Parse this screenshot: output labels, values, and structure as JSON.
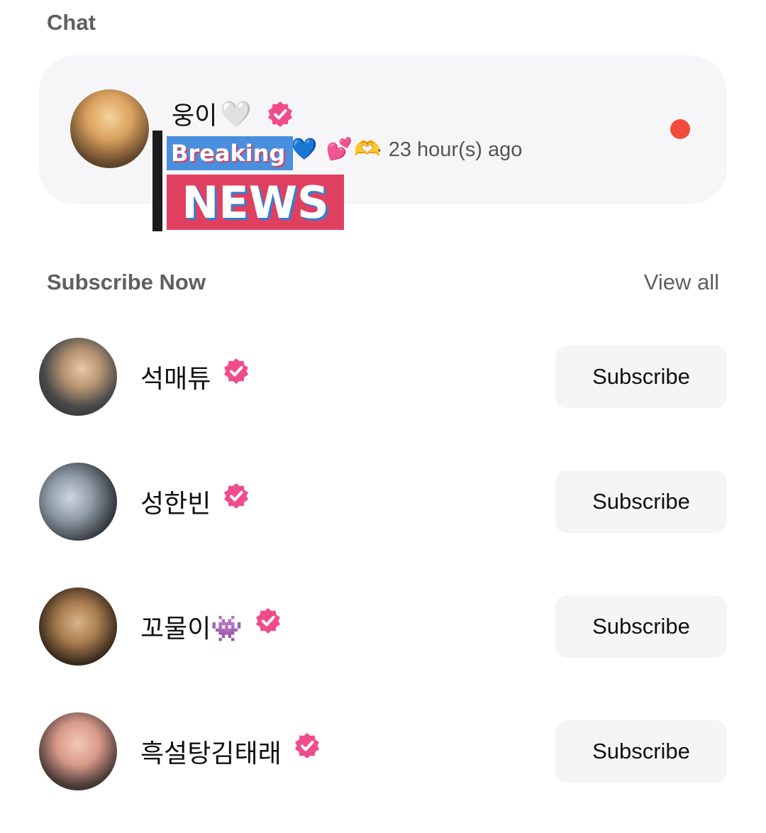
{
  "chat": {
    "title": "Chat",
    "conversation": {
      "name": "웅이",
      "name_emoji": "🤍",
      "time": "· 23 hour(s) ago",
      "preview_emojis": "💙 💕🫶",
      "sticker_line1": "Breaking",
      "sticker_line2": "NEWS",
      "verified_icon": "verified-badge-icon",
      "unread_color": "#f24b3c"
    }
  },
  "subscribe": {
    "title": "Subscribe Now",
    "view_all": "View all",
    "button_label": "Subscribe",
    "accounts": [
      {
        "name": "석매튜"
      },
      {
        "name": "성한빈"
      },
      {
        "name": "꼬물이👾"
      },
      {
        "name": "흑설탕김태래"
      }
    ]
  },
  "colors": {
    "verified": "#f04c8c",
    "section_title": "#5f5f5f",
    "card_bg": "#f6f6f8"
  }
}
